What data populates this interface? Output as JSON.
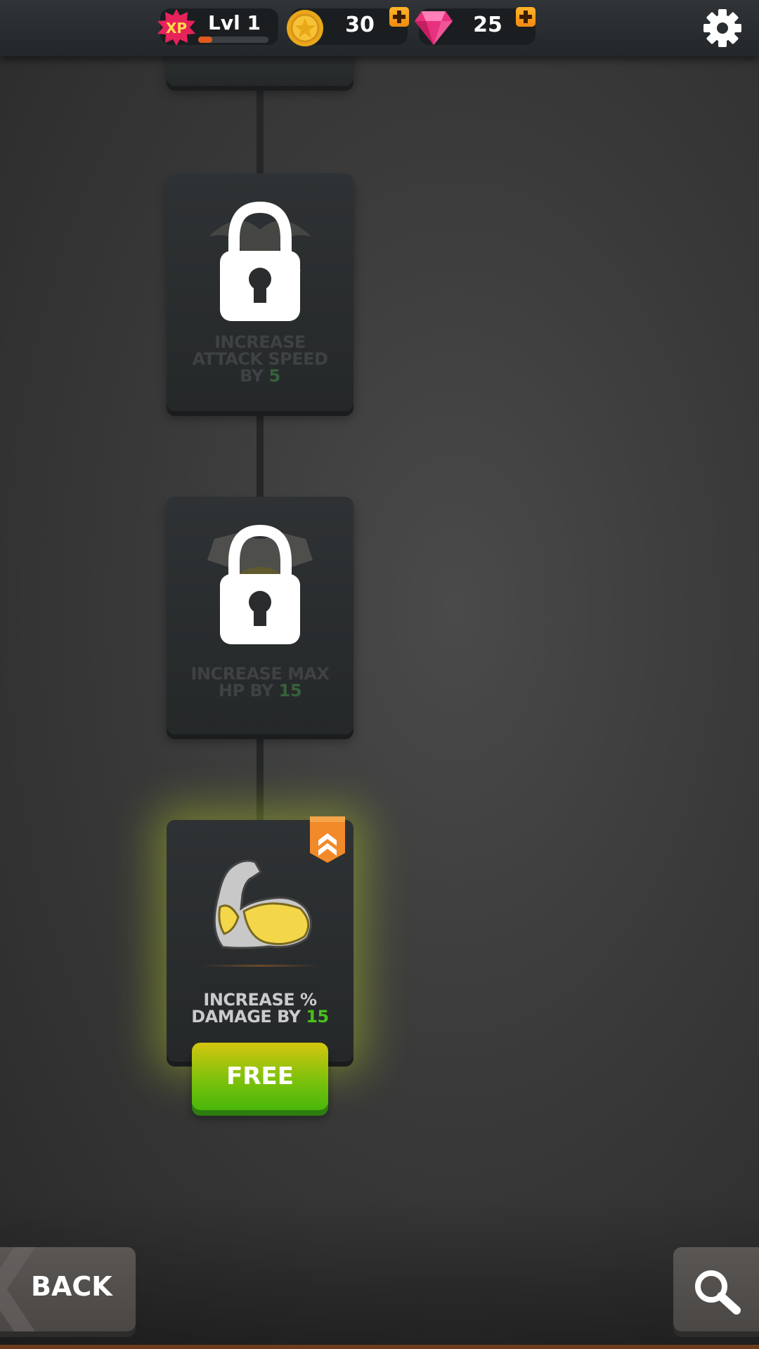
{
  "hud": {
    "level_label": "Lvl 1",
    "xp_badge_text": "XP",
    "xp_progress": 0.2,
    "coins": "30",
    "gems": "25"
  },
  "skills": [
    {
      "title": "INCREASE ATTACK SPEED BY",
      "line1": "INCREASE",
      "line2": "ATTACK SPEED",
      "line3_prefix": "BY ",
      "value": "5",
      "state": "locked",
      "icon": "lock-icon"
    },
    {
      "line1": "INCREASE MAX",
      "line2_prefix": "HP BY ",
      "value": "15",
      "state": "locked",
      "icon": "lock-icon"
    },
    {
      "line1": "INCREASE %",
      "line2_prefix": "DAMAGE BY ",
      "value": "15",
      "state": "available",
      "icon": "flexed-arm-icon",
      "button_label": "FREE"
    }
  ],
  "nav": {
    "back_label": "BACK",
    "search_icon": "magnifier-icon"
  },
  "colors": {
    "highlight_green": "#49c01b",
    "free_button": "#7ec10d",
    "plus_orange": "#f7a01e"
  }
}
